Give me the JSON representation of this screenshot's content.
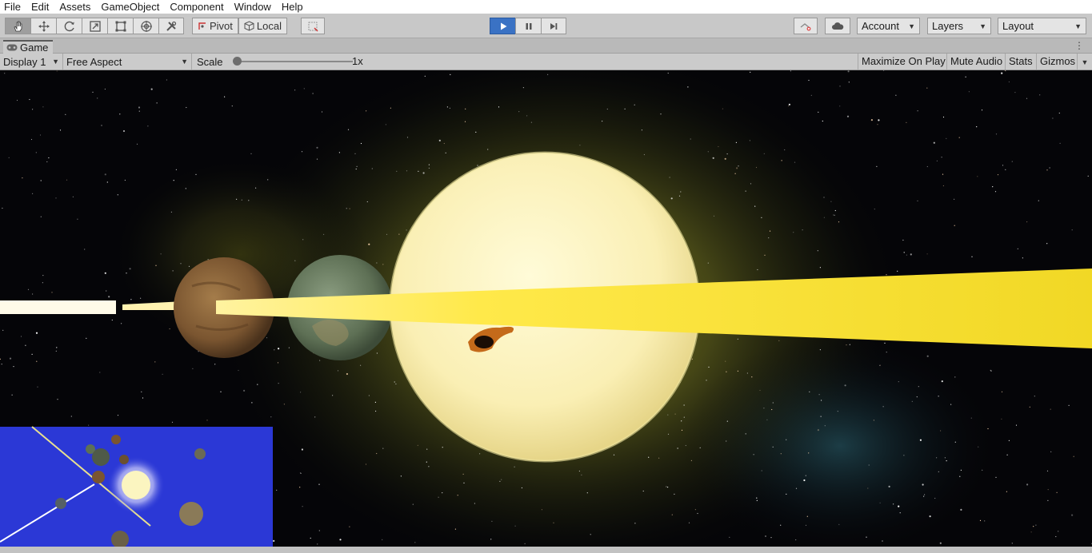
{
  "menu": [
    "File",
    "Edit",
    "Assets",
    "GameObject",
    "Component",
    "Window",
    "Help"
  ],
  "toolbar": {
    "tools": [
      {
        "name": "hand-tool-button",
        "icon": "hand-icon"
      },
      {
        "name": "move-tool-button",
        "icon": "move-icon"
      },
      {
        "name": "rotate-tool-button",
        "icon": "rotate-icon"
      },
      {
        "name": "scale-tool-button",
        "icon": "scale-icon"
      },
      {
        "name": "rect-tool-button",
        "icon": "rect-icon"
      },
      {
        "name": "transform-tool-button",
        "icon": "transform-icon"
      },
      {
        "name": "custom-tool-button",
        "icon": "tools-icon"
      }
    ],
    "pivot_label": "Pivot",
    "local_label": "Local",
    "account_label": "Account",
    "layers_label": "Layers",
    "layout_label": "Layout"
  },
  "game_tab": {
    "title": "Game"
  },
  "game_toolbar": {
    "display": "Display 1",
    "aspect": "Free Aspect",
    "scale_label": "Scale",
    "scale_value": "1x",
    "maximize_label": "Maximize On Play",
    "mute_label": "Mute Audio",
    "stats_label": "Stats",
    "gizmos_label": "Gizmos"
  },
  "colors": {
    "play_active": "#3a72c4",
    "minimap_bg": "#2b38d6",
    "beam": "#f3dc2a",
    "sun": "#fbf5c0"
  }
}
